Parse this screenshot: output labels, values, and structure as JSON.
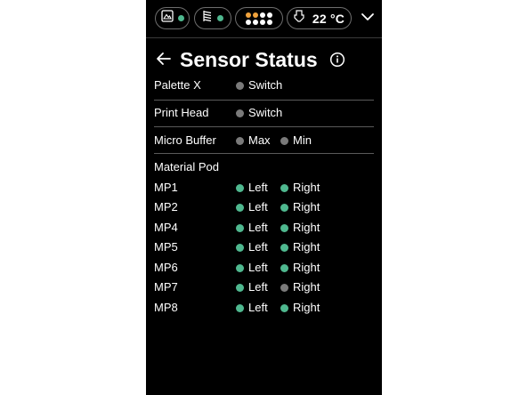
{
  "colors": {
    "active": "#4fb88f",
    "inactive": "#7a7a7a",
    "warning": "#f0a23c",
    "background": "#000000",
    "text": "#ffffff"
  },
  "status_bar": {
    "items": [
      {
        "icon": "printer-icon",
        "dot_state": "active"
      },
      {
        "icon": "spool-icon",
        "dot_state": "active"
      },
      {
        "icon": "dot-grid-icon",
        "dots": [
          "warning",
          "warning",
          "text",
          "text",
          "text",
          "text",
          "text",
          "text"
        ]
      },
      {
        "icon": "thermometer-icon",
        "value": "22 °C"
      }
    ],
    "menu_icon": "chevron-down-icon"
  },
  "header": {
    "back_icon": "arrow-left-icon",
    "title": "Sensor Status",
    "info_icon": "info-icon"
  },
  "sensors": {
    "palette_x": {
      "label": "Palette X",
      "indicators": [
        {
          "name": "Switch",
          "state": "inactive"
        }
      ]
    },
    "print_head": {
      "label": "Print Head",
      "indicators": [
        {
          "name": "Switch",
          "state": "inactive"
        }
      ]
    },
    "micro_buffer": {
      "label": "Micro Buffer",
      "indicators": [
        {
          "name": "Max",
          "state": "inactive"
        },
        {
          "name": "Min",
          "state": "inactive"
        }
      ]
    }
  },
  "material_pod": {
    "title": "Material Pod",
    "rows": [
      {
        "label": "MP1",
        "left": {
          "name": "Left",
          "state": "active"
        },
        "right": {
          "name": "Right",
          "state": "active"
        }
      },
      {
        "label": "MP2",
        "left": {
          "name": "Left",
          "state": "active"
        },
        "right": {
          "name": "Right",
          "state": "active"
        }
      },
      {
        "label": "MP4",
        "left": {
          "name": "Left",
          "state": "active"
        },
        "right": {
          "name": "Right",
          "state": "active"
        }
      },
      {
        "label": "MP5",
        "left": {
          "name": "Left",
          "state": "active"
        },
        "right": {
          "name": "Right",
          "state": "active"
        }
      },
      {
        "label": "MP6",
        "left": {
          "name": "Left",
          "state": "active"
        },
        "right": {
          "name": "Right",
          "state": "active"
        }
      },
      {
        "label": "MP7",
        "left": {
          "name": "Left",
          "state": "active"
        },
        "right": {
          "name": "Right",
          "state": "inactive"
        }
      },
      {
        "label": "MP8",
        "left": {
          "name": "Left",
          "state": "active"
        },
        "right": {
          "name": "Right",
          "state": "active"
        }
      }
    ]
  }
}
